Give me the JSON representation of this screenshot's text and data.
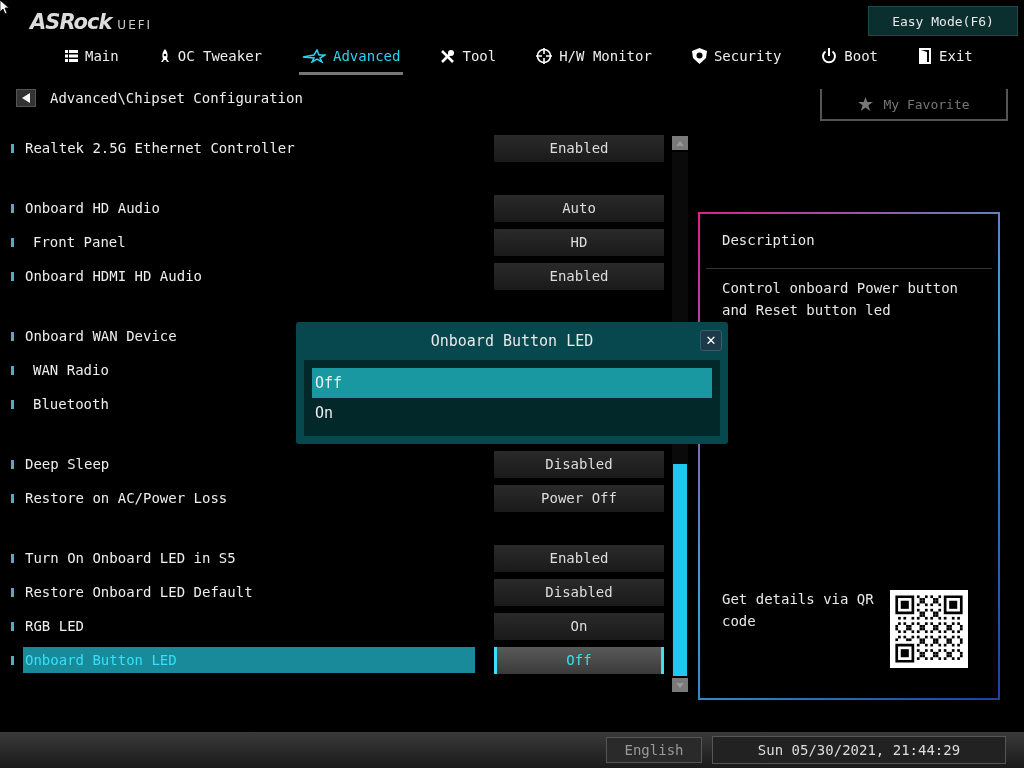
{
  "logo": {
    "brand": "ASRock",
    "suffix": "UEFI"
  },
  "easy_mode_button": "Easy Mode(F6)",
  "tabs": [
    {
      "label": "Main",
      "selected": false
    },
    {
      "label": "OC Tweaker",
      "selected": false
    },
    {
      "label": "Advanced",
      "selected": true
    },
    {
      "label": "Tool",
      "selected": false
    },
    {
      "label": "H/W Monitor",
      "selected": false
    },
    {
      "label": "Security",
      "selected": false
    },
    {
      "label": "Boot",
      "selected": false
    },
    {
      "label": "Exit",
      "selected": false
    }
  ],
  "breadcrumb": "Advanced\\Chipset Configuration",
  "favorite_button": "My Favorite",
  "settings_groups": [
    {
      "items": [
        {
          "label": "Realtek 2.5G Ethernet Controller",
          "value": "Enabled",
          "selected": false
        }
      ]
    },
    {
      "items": [
        {
          "label": "Onboard HD Audio",
          "value": "Auto",
          "selected": false,
          "children": [
            {
              "label": "Front Panel",
              "value": "HD",
              "selected": false
            }
          ]
        },
        {
          "label": "Onboard HDMI HD Audio",
          "value": "Enabled",
          "selected": false
        }
      ]
    },
    {
      "items": [
        {
          "label": "Onboard WAN Device",
          "selected": false,
          "children": [
            {
              "label": "WAN Radio",
              "selected": false
            },
            {
              "label": "Bluetooth",
              "selected": false
            }
          ]
        }
      ]
    },
    {
      "items": [
        {
          "label": "Deep Sleep",
          "value": "Disabled",
          "selected": false
        },
        {
          "label": "Restore on AC/Power Loss",
          "value": "Power Off",
          "selected": false
        }
      ]
    },
    {
      "items": [
        {
          "label": "Turn On Onboard LED in S5",
          "value": "Enabled",
          "selected": false
        },
        {
          "label": "Restore Onboard LED Default",
          "value": "Disabled",
          "selected": false
        },
        {
          "label": "RGB LED",
          "value": "On",
          "selected": false
        },
        {
          "label": "Onboard Button LED",
          "value": "Off",
          "selected": true
        }
      ]
    }
  ],
  "description": {
    "title": "Description",
    "text": "Control onboard Power button and Reset button led",
    "qr_hint": "Get details via QR code"
  },
  "dialog": {
    "title": "Onboard Button LED",
    "close": "✕",
    "options": [
      {
        "label": "Off",
        "selected": true
      },
      {
        "label": "On",
        "selected": false
      }
    ]
  },
  "status_bar": {
    "language": "English",
    "datetime": "Sun 05/30/2021, 21:44:29"
  }
}
